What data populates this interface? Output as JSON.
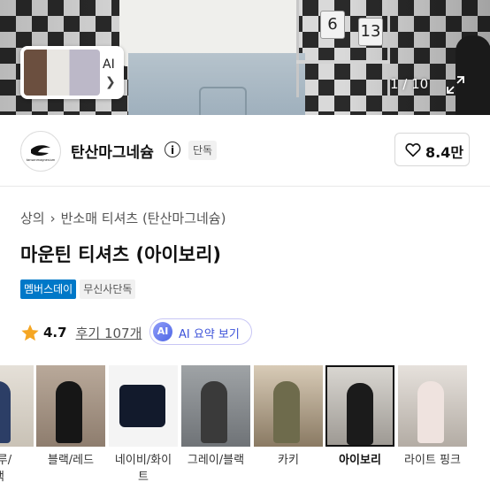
{
  "gallery": {
    "counter": "1 / 10",
    "thumbnail_label": "AI",
    "flip_clock_digits": [
      "6",
      "13"
    ]
  },
  "brand": {
    "name": "탄산마그네슘",
    "logo_text": "tansanmagnesium",
    "exclusive_badge": "단독",
    "like_count": "8.4만"
  },
  "breadcrumb": [
    "상의",
    "반소매 티셔츠 (탄산마그네슘)"
  ],
  "product": {
    "title": "마운틴 티셔츠 (아이보리)",
    "badges": [
      "멤버스데이",
      "무신사단독"
    ],
    "rating": "4.7",
    "reviews": "후기 107개",
    "ai_summary": {
      "icon_text": "AI",
      "label": "AI 요약 보기"
    }
  },
  "colors": {
    "accent_blue": "#0078c8",
    "star": "#f5a623",
    "ai_purple": "#3c52d9"
  },
  "swatches": [
    {
      "label": "블루/\n랙",
      "selected": false
    },
    {
      "label": "블랙/레드",
      "selected": false
    },
    {
      "label": "네이비/화이\n트",
      "selected": false
    },
    {
      "label": "그레이/블랙",
      "selected": false
    },
    {
      "label": "카키",
      "selected": false
    },
    {
      "label": "아이보리",
      "selected": true
    },
    {
      "label": "라이트 핑크",
      "selected": false
    }
  ]
}
